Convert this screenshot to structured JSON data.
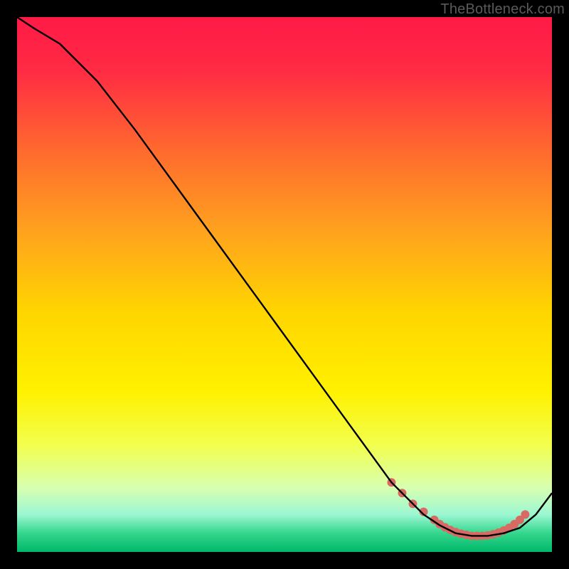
{
  "attribution": "TheBottleneck.com",
  "chart_data": {
    "type": "line",
    "title": "",
    "xlabel": "",
    "ylabel": "",
    "xlim": [
      0,
      100
    ],
    "ylim": [
      0,
      100
    ],
    "background_gradient_stops": [
      {
        "pos": 0.0,
        "color": "#ff1a46"
      },
      {
        "pos": 0.1,
        "color": "#ff2b44"
      },
      {
        "pos": 0.25,
        "color": "#ff6a2e"
      },
      {
        "pos": 0.4,
        "color": "#ffa21e"
      },
      {
        "pos": 0.55,
        "color": "#ffd500"
      },
      {
        "pos": 0.7,
        "color": "#fff100"
      },
      {
        "pos": 0.8,
        "color": "#f2ff4d"
      },
      {
        "pos": 0.88,
        "color": "#d8ffb0"
      },
      {
        "pos": 0.93,
        "color": "#9cf7d3"
      },
      {
        "pos": 0.965,
        "color": "#34d68c"
      },
      {
        "pos": 1.0,
        "color": "#00b86b"
      }
    ],
    "curve": {
      "x": [
        0,
        3,
        8,
        15,
        22,
        30,
        38,
        46,
        54,
        62,
        70,
        73,
        76,
        79,
        82,
        85,
        88,
        91,
        94,
        97,
        100
      ],
      "y": [
        100,
        98,
        95,
        88,
        79,
        68,
        57,
        46,
        35,
        24,
        13,
        10,
        7,
        5,
        3.5,
        3,
        3,
        3.5,
        4.5,
        7,
        11
      ]
    },
    "markers": {
      "x": [
        70,
        72,
        74,
        76,
        78,
        79,
        80,
        81,
        82,
        83,
        84,
        85,
        86,
        87,
        88,
        89,
        90,
        91,
        92,
        93,
        94,
        95
      ],
      "y": [
        13,
        11,
        9,
        7.5,
        6,
        5.2,
        4.6,
        4.1,
        3.7,
        3.4,
        3.2,
        3.0,
        3.0,
        3.0,
        3.1,
        3.3,
        3.6,
        4.0,
        4.5,
        5.2,
        6.0,
        7.0
      ],
      "color": "#d96a63",
      "radius": 6
    }
  }
}
